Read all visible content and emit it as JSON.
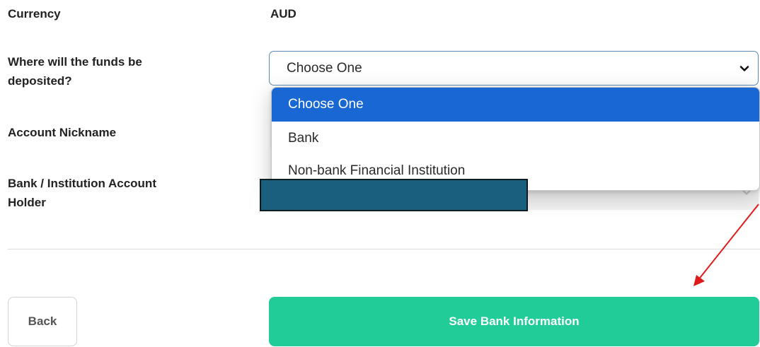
{
  "form": {
    "currency_label": "Currency",
    "currency_value": "AUD",
    "deposit_label_line1": "Where will the funds be",
    "deposit_label_line2": "deposited?",
    "deposit_select_value": "Choose One",
    "nickname_label": "Account Nickname",
    "holder_label_line1": "Bank / Institution Account",
    "holder_label_line2": "Holder"
  },
  "dropdown": {
    "options": [
      "Choose One",
      "Bank",
      "Non-bank Financial Institution"
    ],
    "highlighted_index": 0
  },
  "actions": {
    "back_label": "Back",
    "save_label": "Save Bank Information"
  },
  "colors": {
    "save_button": "#22cc99",
    "option_highlight": "#1967d2",
    "redaction": "#1a5f7e",
    "annotation_arrow": "#e01a1a"
  },
  "icons": {
    "select_chevron": "chevron-down-icon",
    "annotation": "arrow-annotation"
  }
}
